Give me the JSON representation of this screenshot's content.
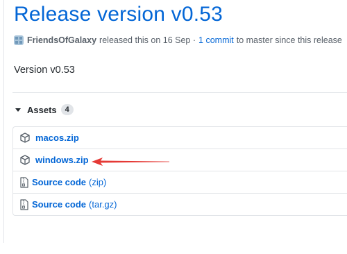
{
  "release": {
    "title": "Release version v0.53",
    "author": "FriendsOfGalaxy",
    "released_text": "released this on 16 Sep ·",
    "commits_link": "1 commit",
    "commits_suffix": "to master since this release",
    "body": "Version v0.53"
  },
  "assets": {
    "label": "Assets",
    "count": "4",
    "items": [
      {
        "name": "macos.zip",
        "icon": "package-icon"
      },
      {
        "name": "windows.zip",
        "icon": "package-icon"
      },
      {
        "name": "Source code",
        "format": "(zip)",
        "icon": "file-zip-icon"
      },
      {
        "name": "Source code",
        "format": "(tar.gz)",
        "icon": "file-zip-icon"
      }
    ]
  },
  "annotation": {
    "arrow_color": "#e53935",
    "points_to": "windows.zip"
  },
  "colors": {
    "link": "#0366d6",
    "text": "#24292e",
    "muted": "#586069",
    "border": "#e1e4e8"
  }
}
